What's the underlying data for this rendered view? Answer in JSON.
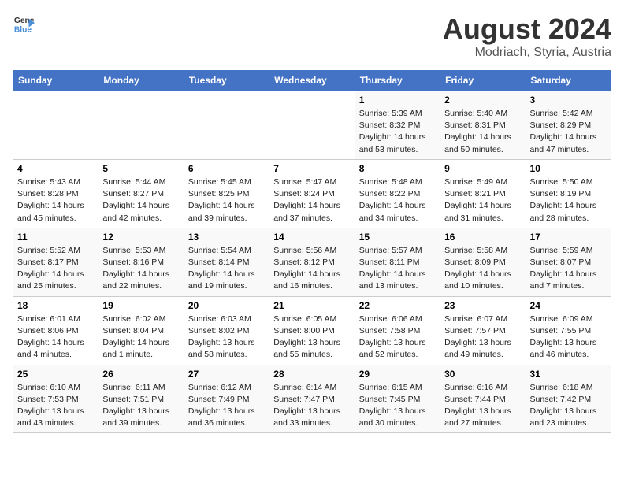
{
  "header": {
    "logo_general": "General",
    "logo_blue": "Blue",
    "title": "August 2024",
    "subtitle": "Modriach, Styria, Austria"
  },
  "days_of_week": [
    "Sunday",
    "Monday",
    "Tuesday",
    "Wednesday",
    "Thursday",
    "Friday",
    "Saturday"
  ],
  "weeks": [
    [
      {
        "num": "",
        "info": ""
      },
      {
        "num": "",
        "info": ""
      },
      {
        "num": "",
        "info": ""
      },
      {
        "num": "",
        "info": ""
      },
      {
        "num": "1",
        "info": "Sunrise: 5:39 AM\nSunset: 8:32 PM\nDaylight: 14 hours\nand 53 minutes."
      },
      {
        "num": "2",
        "info": "Sunrise: 5:40 AM\nSunset: 8:31 PM\nDaylight: 14 hours\nand 50 minutes."
      },
      {
        "num": "3",
        "info": "Sunrise: 5:42 AM\nSunset: 8:29 PM\nDaylight: 14 hours\nand 47 minutes."
      }
    ],
    [
      {
        "num": "4",
        "info": "Sunrise: 5:43 AM\nSunset: 8:28 PM\nDaylight: 14 hours\nand 45 minutes."
      },
      {
        "num": "5",
        "info": "Sunrise: 5:44 AM\nSunset: 8:27 PM\nDaylight: 14 hours\nand 42 minutes."
      },
      {
        "num": "6",
        "info": "Sunrise: 5:45 AM\nSunset: 8:25 PM\nDaylight: 14 hours\nand 39 minutes."
      },
      {
        "num": "7",
        "info": "Sunrise: 5:47 AM\nSunset: 8:24 PM\nDaylight: 14 hours\nand 37 minutes."
      },
      {
        "num": "8",
        "info": "Sunrise: 5:48 AM\nSunset: 8:22 PM\nDaylight: 14 hours\nand 34 minutes."
      },
      {
        "num": "9",
        "info": "Sunrise: 5:49 AM\nSunset: 8:21 PM\nDaylight: 14 hours\nand 31 minutes."
      },
      {
        "num": "10",
        "info": "Sunrise: 5:50 AM\nSunset: 8:19 PM\nDaylight: 14 hours\nand 28 minutes."
      }
    ],
    [
      {
        "num": "11",
        "info": "Sunrise: 5:52 AM\nSunset: 8:17 PM\nDaylight: 14 hours\nand 25 minutes."
      },
      {
        "num": "12",
        "info": "Sunrise: 5:53 AM\nSunset: 8:16 PM\nDaylight: 14 hours\nand 22 minutes."
      },
      {
        "num": "13",
        "info": "Sunrise: 5:54 AM\nSunset: 8:14 PM\nDaylight: 14 hours\nand 19 minutes."
      },
      {
        "num": "14",
        "info": "Sunrise: 5:56 AM\nSunset: 8:12 PM\nDaylight: 14 hours\nand 16 minutes."
      },
      {
        "num": "15",
        "info": "Sunrise: 5:57 AM\nSunset: 8:11 PM\nDaylight: 14 hours\nand 13 minutes."
      },
      {
        "num": "16",
        "info": "Sunrise: 5:58 AM\nSunset: 8:09 PM\nDaylight: 14 hours\nand 10 minutes."
      },
      {
        "num": "17",
        "info": "Sunrise: 5:59 AM\nSunset: 8:07 PM\nDaylight: 14 hours\nand 7 minutes."
      }
    ],
    [
      {
        "num": "18",
        "info": "Sunrise: 6:01 AM\nSunset: 8:06 PM\nDaylight: 14 hours\nand 4 minutes."
      },
      {
        "num": "19",
        "info": "Sunrise: 6:02 AM\nSunset: 8:04 PM\nDaylight: 14 hours\nand 1 minute."
      },
      {
        "num": "20",
        "info": "Sunrise: 6:03 AM\nSunset: 8:02 PM\nDaylight: 13 hours\nand 58 minutes."
      },
      {
        "num": "21",
        "info": "Sunrise: 6:05 AM\nSunset: 8:00 PM\nDaylight: 13 hours\nand 55 minutes."
      },
      {
        "num": "22",
        "info": "Sunrise: 6:06 AM\nSunset: 7:58 PM\nDaylight: 13 hours\nand 52 minutes."
      },
      {
        "num": "23",
        "info": "Sunrise: 6:07 AM\nSunset: 7:57 PM\nDaylight: 13 hours\nand 49 minutes."
      },
      {
        "num": "24",
        "info": "Sunrise: 6:09 AM\nSunset: 7:55 PM\nDaylight: 13 hours\nand 46 minutes."
      }
    ],
    [
      {
        "num": "25",
        "info": "Sunrise: 6:10 AM\nSunset: 7:53 PM\nDaylight: 13 hours\nand 43 minutes."
      },
      {
        "num": "26",
        "info": "Sunrise: 6:11 AM\nSunset: 7:51 PM\nDaylight: 13 hours\nand 39 minutes."
      },
      {
        "num": "27",
        "info": "Sunrise: 6:12 AM\nSunset: 7:49 PM\nDaylight: 13 hours\nand 36 minutes."
      },
      {
        "num": "28",
        "info": "Sunrise: 6:14 AM\nSunset: 7:47 PM\nDaylight: 13 hours\nand 33 minutes."
      },
      {
        "num": "29",
        "info": "Sunrise: 6:15 AM\nSunset: 7:45 PM\nDaylight: 13 hours\nand 30 minutes."
      },
      {
        "num": "30",
        "info": "Sunrise: 6:16 AM\nSunset: 7:44 PM\nDaylight: 13 hours\nand 27 minutes."
      },
      {
        "num": "31",
        "info": "Sunrise: 6:18 AM\nSunset: 7:42 PM\nDaylight: 13 hours\nand 23 minutes."
      }
    ]
  ]
}
